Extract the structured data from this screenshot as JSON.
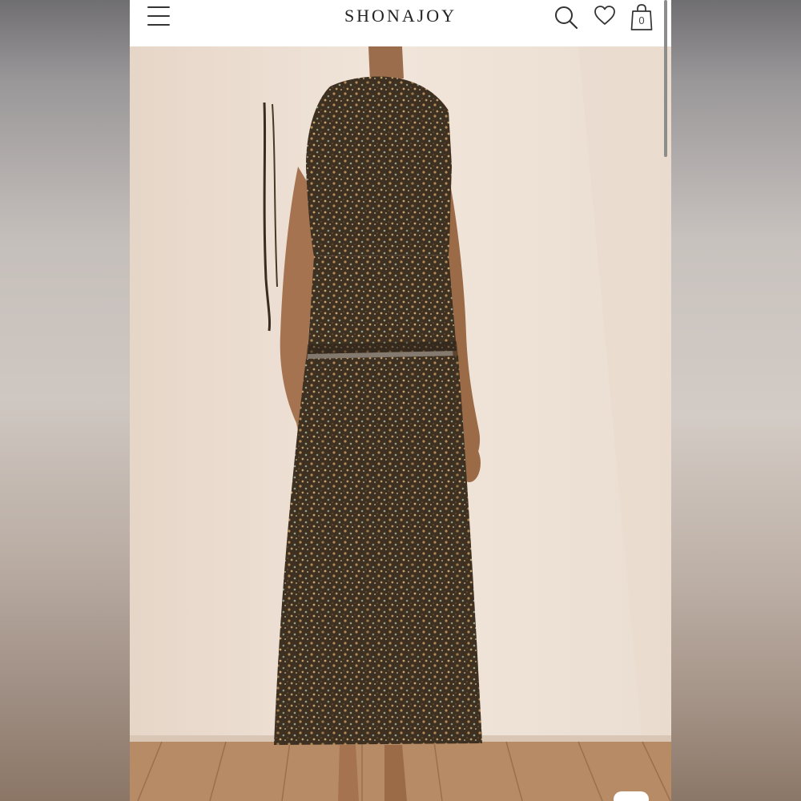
{
  "header": {
    "brand": "SHONAJOY",
    "bag_count": "0"
  },
  "icons": {
    "menu": "hamburger-menu-icon",
    "search": "search-icon",
    "wishlist": "heart-icon",
    "bag": "shopping-bag-icon"
  },
  "colors": {
    "header_bg": "#ffffff",
    "wall": "#efe2d6",
    "floor": "#b98d67",
    "dress": "#4a3b2b"
  },
  "product_image": {
    "alt": ""
  }
}
